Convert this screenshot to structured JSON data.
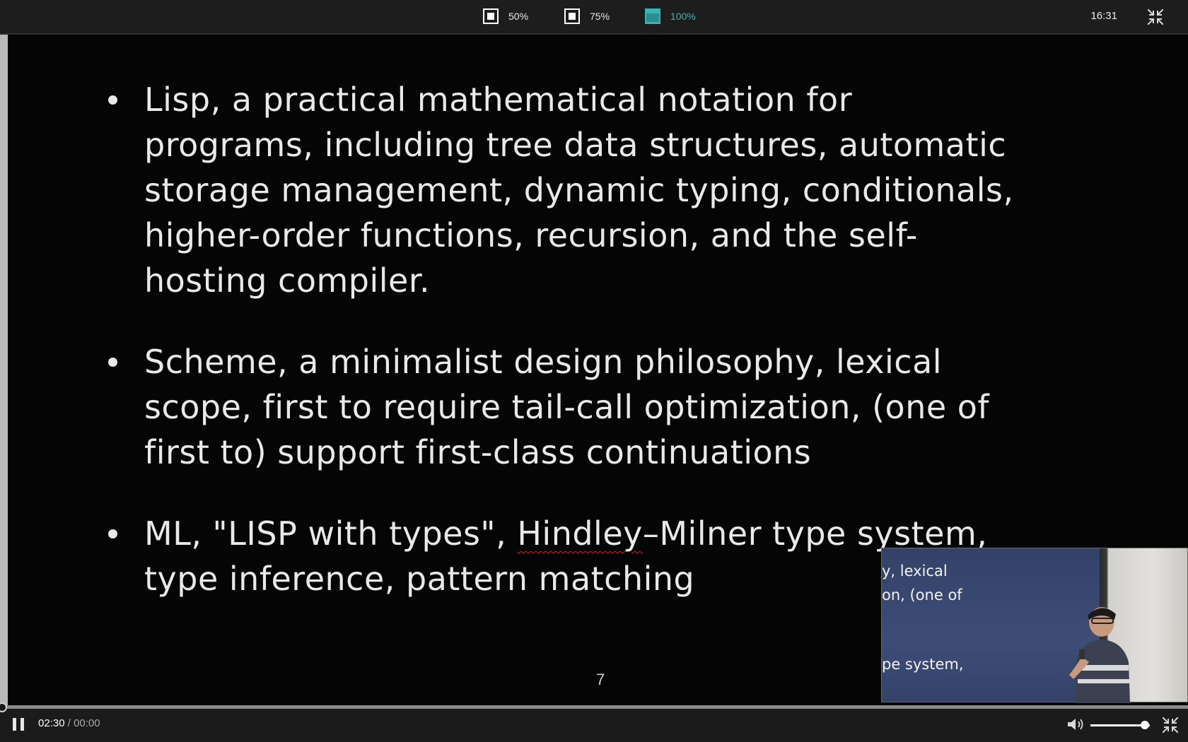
{
  "topbar": {
    "zoom_options": [
      {
        "label": "50%",
        "active": false,
        "icon": "square-icon"
      },
      {
        "label": "75%",
        "active": false,
        "icon": "square-icon"
      },
      {
        "label": "100%",
        "active": true,
        "icon": "square-icon"
      }
    ],
    "clock": "16:31",
    "exit_fullscreen_icon": "compress-icon",
    "accent_color": "#3ab3b4"
  },
  "slide": {
    "bullets": [
      {
        "lines": [
          "Lisp, a practical mathematical notation for",
          "programs, including tree data structures, automatic",
          "storage management, dynamic typing, conditionals,",
          "higher-order functions, recursion, and the self-",
          "hosting compiler."
        ]
      },
      {
        "lines": [
          "Scheme, a minimalist design philosophy, lexical",
          "scope, first to require tail-call optimization, (one of",
          "first to) support first-class continuations"
        ]
      },
      {
        "line1_pre": "ML, \"LISP with types\", ",
        "line1_squiggle": "Hindley",
        "line1_post": "–Milner type system,",
        "line2": "type inference, pattern matching"
      }
    ],
    "page_number": "7"
  },
  "pip": {
    "slide_lines": [
      "y, lexical",
      "on, (one of",
      "pe system,"
    ]
  },
  "controls": {
    "current_time": "02:30",
    "separator": " / ",
    "duration": "00:00",
    "pause_icon": "pause-icon",
    "volume_icon": "speaker-icon",
    "volume_level": 0.92,
    "playback_progress": 0.0,
    "fullscreen_icon": "compress-icon"
  }
}
